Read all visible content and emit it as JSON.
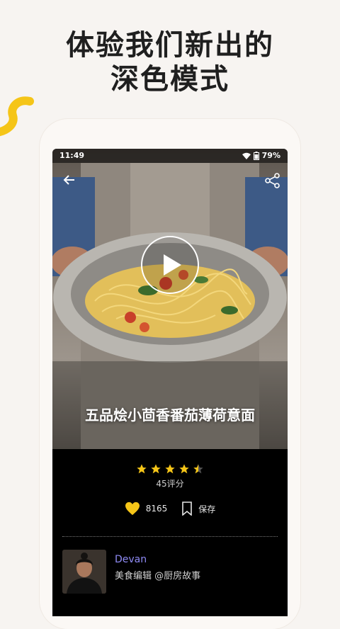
{
  "headline": {
    "line1": "体验我们新出的",
    "line2": "深色模式"
  },
  "status_bar": {
    "time": "11:49",
    "battery": "79%"
  },
  "recipe": {
    "title": "五品烩小茴香番茄薄荷意面",
    "rating": 4.5,
    "rating_count": "45评分",
    "likes": "8165",
    "save_label": "保存"
  },
  "author": {
    "name": "Devan",
    "role": "美食编辑 @厨房故事"
  },
  "colors": {
    "accent_yellow": "#f5c518",
    "author_purple": "#8f8bf5",
    "background": "#f7f4f1"
  }
}
